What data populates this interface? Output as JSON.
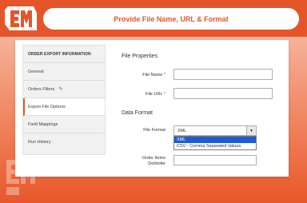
{
  "header": {
    "title": "Provide File Name, URL & Format"
  },
  "sidebar": {
    "heading": "ORDER EXPORT INFORMATION",
    "items": [
      {
        "label": "General"
      },
      {
        "label": "Orders Filters",
        "icon": "pencil-icon"
      },
      {
        "label": "Export File Options",
        "active": true
      },
      {
        "label": "Field Mappings"
      },
      {
        "label": "Run History"
      }
    ]
  },
  "form": {
    "file_properties_title": "File Properties",
    "file_name_label": "File Name",
    "file_name_value": "",
    "file_url_label": "File URL",
    "file_url_value": "",
    "required_mark": "*",
    "data_format_title": "Data Format",
    "file_format_label": "File Format",
    "file_format_value": "XML",
    "file_format_options": [
      "XML",
      "CSV - Comma Separated Values"
    ],
    "delimiter_label_line1": "Order Items",
    "delimiter_label_line2": "Delimiter",
    "delimiter_value": ""
  },
  "colors": {
    "brand_orange": "#e4562a",
    "selected_option": "#1f5bd6",
    "required": "#e02b27"
  }
}
